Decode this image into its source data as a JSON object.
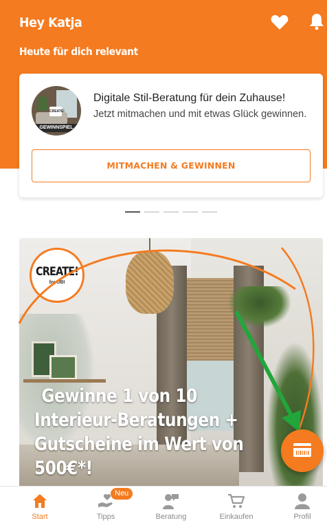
{
  "header": {
    "greeting": "Hey Katja",
    "subtitle": "Heute für dich relevant"
  },
  "card": {
    "thumb_badge": "GEWINNSPIEL",
    "title": "Digitale Stil-Beratung für dein Zuhause!",
    "text": "Jetzt mitmachen und mit etwas Glück gewinnen.",
    "button_label": "MITMACHEN & GEWINNEN"
  },
  "carousel": {
    "page_count": 5,
    "active_index": 0
  },
  "banner": {
    "logo_text": "CREATE!",
    "logo_sub": "by OBI",
    "headline_lines": [
      "Gewinne 1 von 10",
      "Interieur-Beratungen +",
      "Gutscheine im Wert von",
      "500€*!"
    ]
  },
  "tabs": [
    {
      "label": "Start",
      "icon": "home-icon",
      "active": true
    },
    {
      "label": "Tipps",
      "icon": "tips-icon",
      "badge": "Neu"
    },
    {
      "label": "Beratung",
      "icon": "advice-icon"
    },
    {
      "label": "Einkaufen",
      "icon": "cart-icon"
    },
    {
      "label": "Profil",
      "icon": "profile-icon"
    }
  ],
  "colors": {
    "accent": "#f47b20",
    "arrow": "#22a63a"
  }
}
